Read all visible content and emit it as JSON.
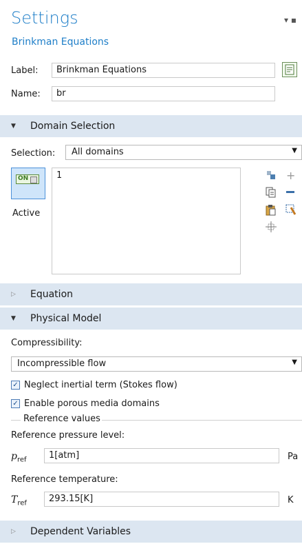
{
  "header": {
    "title": "Settings",
    "subtitle": "Brinkman Equations",
    "pin_glyph": "▾ ▪"
  },
  "identity": {
    "label_caption": "Label:",
    "label_value": "Brinkman Equations",
    "name_caption": "Name:",
    "name_value": "br"
  },
  "domain_selection": {
    "section_title": "Domain Selection",
    "selection_caption": "Selection:",
    "selection_value": "All domains",
    "active_toggle_text": "ON",
    "active_label": "Active",
    "list_items": [
      "1"
    ]
  },
  "equation": {
    "section_title": "Equation"
  },
  "physical_model": {
    "section_title": "Physical Model",
    "compressibility_caption": "Compressibility:",
    "compressibility_value": "Incompressible flow",
    "check_neglect_inertial": "Neglect inertial term (Stokes flow)",
    "check_porous_media": "Enable porous media domains",
    "reference_values_title": "Reference values",
    "ref_pressure_caption": "Reference pressure level:",
    "p_ref_symbol": "p",
    "p_ref_sub": "ref",
    "p_ref_value": "1[atm]",
    "p_ref_unit": "Pa",
    "ref_temperature_caption": "Reference temperature:",
    "t_ref_symbol": "T",
    "t_ref_sub": "ref",
    "t_ref_value": "293.15[K]",
    "t_ref_unit": "K"
  },
  "dependent_variables": {
    "section_title": "Dependent Variables"
  }
}
